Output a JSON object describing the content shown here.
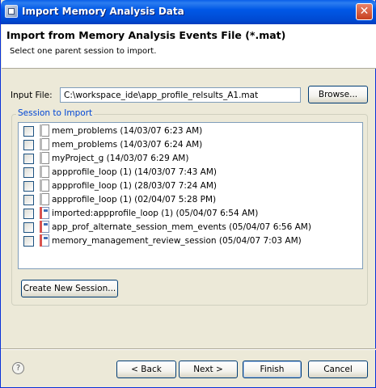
{
  "window": {
    "title": "Import Memory Analysis Data",
    "close_symbol": "✕"
  },
  "header": {
    "title": "Import from Memory Analysis Events File (*.mat)",
    "description": "Select one parent session to import."
  },
  "input_file": {
    "label": "Input File:",
    "value": "C:\\workspace_ide\\app_profile_relsults_A1.mat",
    "browse_label": "Browse..."
  },
  "sessions": {
    "group_label": "Session to Import",
    "items": [
      {
        "label": "mem_problems (14/03/07 6:23 AM)",
        "checked": false,
        "icon": "document-icon"
      },
      {
        "label": "mem_problems (14/03/07 6:24 AM)",
        "checked": false,
        "icon": "document-icon"
      },
      {
        "label": "myProject_g (14/03/07 6:29 AM)",
        "checked": false,
        "icon": "document-icon"
      },
      {
        "label": "appprofile_loop (1) (14/03/07 7:43 AM)",
        "checked": false,
        "icon": "document-icon"
      },
      {
        "label": "appprofile_loop (1) (28/03/07 7:24 AM)",
        "checked": false,
        "icon": "document-icon"
      },
      {
        "label": "appprofile_loop (1) (02/04/07 5:28 PM)",
        "checked": false,
        "icon": "document-icon"
      },
      {
        "label": "imported:appprofile_loop (1) (05/04/07 6:54 AM)",
        "checked": false,
        "icon": "imported-session-icon"
      },
      {
        "label": "app_prof_alternate_session_mem_events (05/04/07 6:56 AM)",
        "checked": false,
        "icon": "imported-session-icon"
      },
      {
        "label": "memory_management_review_session (05/04/07 7:03 AM)",
        "checked": false,
        "icon": "imported-session-icon"
      }
    ],
    "create_button_label": "Create New Session..."
  },
  "footer": {
    "help_symbol": "?",
    "back_label": "< Back",
    "next_label": "Next >",
    "finish_label": "Finish",
    "cancel_label": "Cancel"
  },
  "colors": {
    "title_bar": "#0058e6",
    "group_label": "#0046d5",
    "dialog_background": "#ece9d8"
  }
}
